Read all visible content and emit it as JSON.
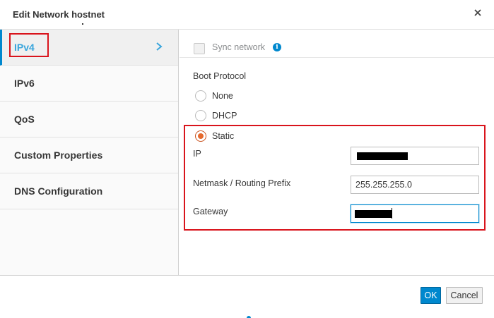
{
  "dialog": {
    "title": "Edit Network hostnet",
    "close_icon": "close-icon"
  },
  "nav": {
    "items": [
      {
        "label": "IPv4",
        "active": true
      },
      {
        "label": "IPv6",
        "active": false
      },
      {
        "label": "QoS",
        "active": false
      },
      {
        "label": "Custom Properties",
        "active": false
      },
      {
        "label": "DNS Configuration",
        "active": false
      }
    ],
    "active_icon": "chevron-right-icon"
  },
  "sync": {
    "label": "Sync network",
    "checked": false,
    "info_icon": "info-icon",
    "info_glyph": "i"
  },
  "boot_protocol": {
    "label": "Boot Protocol",
    "options": [
      {
        "label": "None",
        "selected": false
      },
      {
        "label": "DHCP",
        "selected": false
      },
      {
        "label": "Static",
        "selected": true
      }
    ]
  },
  "fields": {
    "ip": {
      "label": "IP",
      "value": "",
      "redacted": true
    },
    "netmask": {
      "label": "Netmask / Routing Prefix",
      "value": "255.255.255.0"
    },
    "gateway": {
      "label": "Gateway",
      "value": "",
      "redacted": true,
      "focused": true
    }
  },
  "footer": {
    "ok_label": "OK",
    "cancel_label": "Cancel"
  },
  "colors": {
    "accent": "#0088ce",
    "highlight": "#d9141c",
    "radio_checked": "#e5692d"
  }
}
